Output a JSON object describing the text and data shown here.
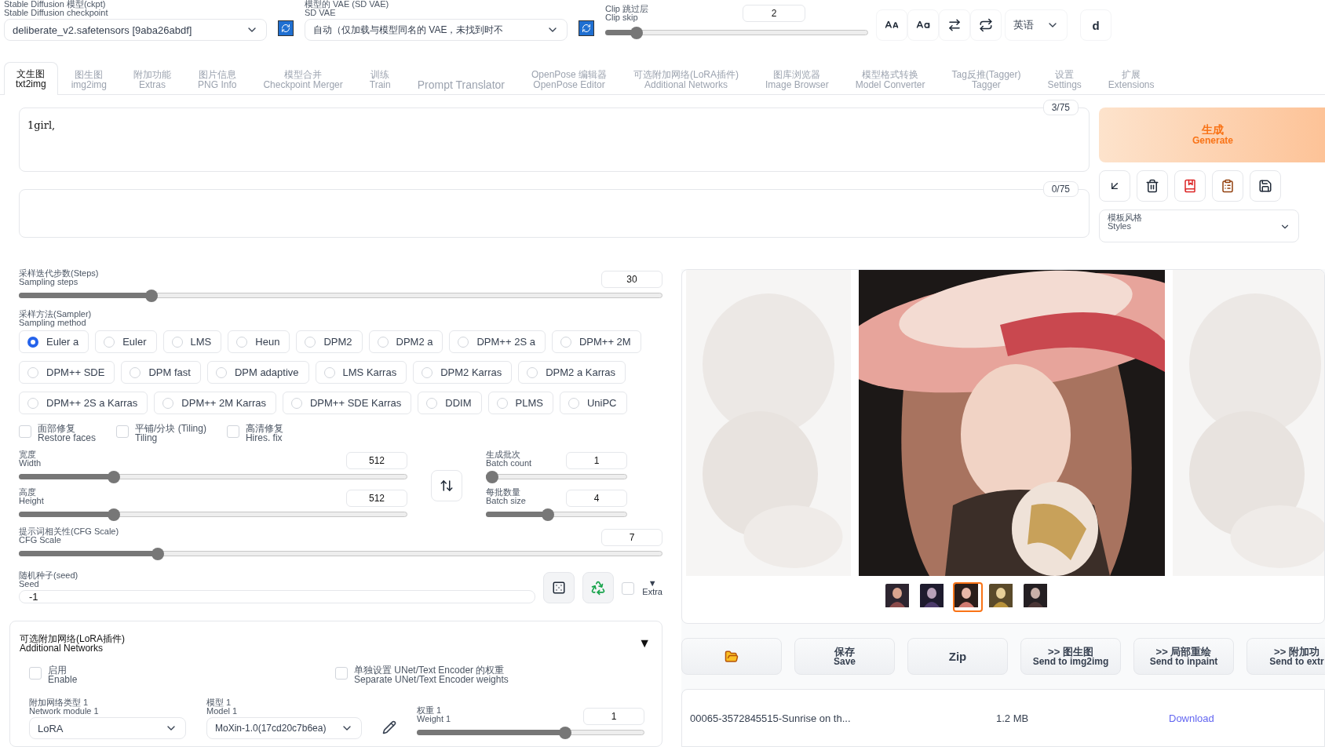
{
  "top": {
    "checkpoint": {
      "label": "Stable Diffusion 模型(ckpt)",
      "sublabel": "Stable Diffusion checkpoint",
      "value": "deliberate_v2.safetensors [9aba26abdf]"
    },
    "vae": {
      "label": "模型的 VAE (SD VAE)",
      "sublabel": "SD VAE",
      "value": "自动（仅加载与模型同名的 VAE，未找到时不"
    },
    "clip_skip": {
      "label": "Clip 跳过层",
      "sublabel": "Clip skip",
      "value": "2",
      "level": 0.1
    },
    "language": "英语",
    "user": "d"
  },
  "tabs": [
    {
      "label": "文生图",
      "sublabel": "txt2img",
      "selected": true
    },
    {
      "label": "图生图",
      "sublabel": "img2img",
      "selected": false
    },
    {
      "label": "附加功能",
      "sublabel": "Extras",
      "selected": false
    },
    {
      "label": "图片信息",
      "sublabel": "PNG Info",
      "selected": false
    },
    {
      "label": "模型合并",
      "sublabel": "Checkpoint Merger",
      "selected": false
    },
    {
      "label": "训练",
      "sublabel": "Train",
      "selected": false
    },
    {
      "label": "Prompt Translator",
      "selected": false
    },
    {
      "label": "OpenPose 编辑器",
      "sublabel": "OpenPose Editor",
      "selected": false
    },
    {
      "label": "可选附加网络(LoRA插件)",
      "sublabel": "Additional Networks",
      "selected": false
    },
    {
      "label": "图库浏览器",
      "sublabel": "Image Browser",
      "selected": false
    },
    {
      "label": "模型格式转换",
      "sublabel": "Model Converter",
      "selected": false
    },
    {
      "label": "Tag反推(Tagger)",
      "sublabel": "Tagger",
      "selected": false
    },
    {
      "label": "设置",
      "sublabel": "Settings",
      "selected": false
    },
    {
      "label": "扩展",
      "sublabel": "Extensions",
      "selected": false
    }
  ],
  "prompt": {
    "value": "1girl,",
    "counter": "3/75"
  },
  "negative_prompt": {
    "counter": "0/75"
  },
  "generate": {
    "label": "生成",
    "sublabel": "Generate"
  },
  "styles": {
    "label": "模板风格",
    "sublabel": "Styles"
  },
  "steps": {
    "label": "采样迭代步数(Steps)",
    "sublabel": "Sampling steps",
    "value": "30",
    "level": 0.2
  },
  "sampler": {
    "label": "采样方法(Sampler)",
    "sublabel": "Sampling method",
    "options": [
      {
        "label": "Euler a",
        "selected": true
      },
      {
        "label": "Euler",
        "selected": false
      },
      {
        "label": "LMS",
        "selected": false
      },
      {
        "label": "Heun",
        "selected": false
      },
      {
        "label": "DPM2",
        "selected": false
      },
      {
        "label": "DPM2 a",
        "selected": false
      },
      {
        "label": "DPM++ 2S a",
        "selected": false
      },
      {
        "label": "DPM++ 2M",
        "selected": false
      },
      {
        "label": "DPM++ SDE",
        "selected": false
      },
      {
        "label": "DPM fast",
        "selected": false
      },
      {
        "label": "DPM adaptive",
        "selected": false
      },
      {
        "label": "LMS Karras",
        "selected": false
      },
      {
        "label": "DPM2 Karras",
        "selected": false
      },
      {
        "label": "DPM2 a Karras",
        "selected": false
      },
      {
        "label": "DPM++ 2S a Karras",
        "selected": false
      },
      {
        "label": "DPM++ 2M Karras",
        "selected": false
      },
      {
        "label": "DPM++ SDE Karras",
        "selected": false
      },
      {
        "label": "DDIM",
        "selected": false
      },
      {
        "label": "PLMS",
        "selected": false
      },
      {
        "label": "UniPC",
        "selected": false
      }
    ]
  },
  "options": [
    {
      "label": "面部修复",
      "sublabel": "Restore faces",
      "checked": false
    },
    {
      "label": "平铺/分块 (Tiling)",
      "sublabel": "Tiling",
      "checked": false
    },
    {
      "label": "高清修复",
      "sublabel": "Hires. fix",
      "checked": false
    }
  ],
  "size_sliders": [
    {
      "label": "宽度",
      "sublabel": "Width",
      "value": "512",
      "level": 0.235
    },
    {
      "label": "高度",
      "sublabel": "Height",
      "value": "512",
      "level": 0.235
    }
  ],
  "batch_sliders": [
    {
      "label": "生成批次",
      "sublabel": "Batch count",
      "value": "1",
      "level": 0.0
    },
    {
      "label": "每批数量",
      "sublabel": "Batch size",
      "value": "4",
      "level": 0.43
    }
  ],
  "cfg": {
    "label": "提示词相关性(CFG Scale)",
    "sublabel": "CFG Scale",
    "value": "7",
    "level": 0.21
  },
  "seed": {
    "label": "随机种子(seed)",
    "sublabel": "Seed",
    "value": "-1",
    "extra_checked": false,
    "extra_toggle": "▼",
    "extra_label": "Extra"
  },
  "additional_networks": {
    "title": "可选附加网络(LoRA插件)",
    "subtitle": "Additional Networks",
    "toggle": "▼",
    "enable": {
      "label": "启用",
      "sublabel": "Enable",
      "checked": false
    },
    "separate": {
      "label": "单独设置 UNet/Text Encoder 的权重",
      "sublabel": "Separate UNet/Text Encoder weights",
      "checked": false
    },
    "module": {
      "label": "附加网络类型 1",
      "sublabel": "Network module 1",
      "value": "LoRA"
    },
    "model": {
      "label": "模型 1",
      "sublabel": "Model 1",
      "value": "MoXin-1.0(17cd20c7b6ea)"
    },
    "weight": {
      "label": "权重 1",
      "sublabel": "Weight 1",
      "value": "1",
      "level": 0.66
    }
  },
  "gallery": {
    "thumbnails": [
      {
        "selected": false
      },
      {
        "selected": false
      },
      {
        "selected": true
      },
      {
        "selected": false
      },
      {
        "selected": false
      }
    ]
  },
  "actions": [
    {
      "kind": "folder"
    },
    {
      "kind": "text",
      "label": "保存",
      "sublabel": "Save"
    },
    {
      "kind": "text",
      "label": "Zip"
    },
    {
      "kind": "text",
      "label": ">> 图生图",
      "sublabel": "Send to img2img"
    },
    {
      "kind": "text",
      "label": ">> 局部重绘",
      "sublabel": "Send to inpaint"
    },
    {
      "kind": "text",
      "label": ">> 附加功",
      "sublabel": "Send to extr"
    }
  ],
  "file": {
    "name": "00065-3572845515-Sunrise on th...",
    "size": "1.2 MB",
    "link": "Download"
  }
}
